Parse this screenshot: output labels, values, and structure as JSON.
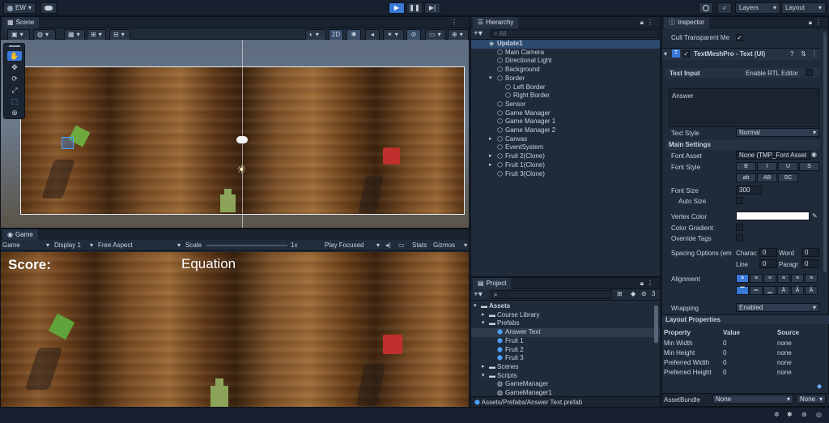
{
  "toolbar": {
    "account": "EW",
    "layers": "Layers",
    "layout": "Layout"
  },
  "scene": {
    "tab": "Scene",
    "mode_2d": "2D"
  },
  "game": {
    "tab": "Game",
    "view": "Game",
    "display": "Display 1",
    "aspect": "Free Aspect",
    "scale_label": "Scale",
    "scale_value": "1x",
    "play_focused": "Play Focused",
    "stats": "Stats",
    "gizmos": "Gizmos",
    "score_text": "Score:",
    "equation_text": "Equation"
  },
  "hierarchy": {
    "tab": "Hierarchy",
    "search_placeholder": "All",
    "items": [
      {
        "label": "Update1",
        "depth": 0,
        "kind": "scene",
        "bold": true
      },
      {
        "label": "Main Camera",
        "depth": 1
      },
      {
        "label": "Directional Light",
        "depth": 1
      },
      {
        "label": "Background",
        "depth": 1
      },
      {
        "label": "Border",
        "depth": 1,
        "arrow": "open"
      },
      {
        "label": "Left Border",
        "depth": 2
      },
      {
        "label": "Right Border",
        "depth": 2
      },
      {
        "label": "Sensor",
        "depth": 1
      },
      {
        "label": "Game Manager",
        "depth": 1
      },
      {
        "label": "Game Manager 1",
        "depth": 1
      },
      {
        "label": "Game Manager 2",
        "depth": 1
      },
      {
        "label": "Canvas",
        "depth": 1,
        "arrow": "closed"
      },
      {
        "label": "EventSystem",
        "depth": 1
      },
      {
        "label": "Fruit 2(Clone)",
        "depth": 1,
        "arrow": "closed"
      },
      {
        "label": "Fruit 1(Clone)",
        "depth": 1,
        "arrow": "closed"
      },
      {
        "label": "Fruit 3(Clone)",
        "depth": 1
      }
    ]
  },
  "project": {
    "tab": "Project",
    "count": "3",
    "items": [
      {
        "label": "Assets",
        "depth": 0,
        "kind": "folder",
        "arrow": "open",
        "bold": true
      },
      {
        "label": "Course Library",
        "depth": 1,
        "kind": "folder",
        "arrow": "closed"
      },
      {
        "label": "Prefabs",
        "depth": 1,
        "kind": "folder",
        "arrow": "open"
      },
      {
        "label": "Answer Text",
        "depth": 2,
        "kind": "prefab",
        "selected": true
      },
      {
        "label": "Fruit 1",
        "depth": 2,
        "kind": "prefab"
      },
      {
        "label": "Fruit 2",
        "depth": 2,
        "kind": "prefab"
      },
      {
        "label": "Fruit 3",
        "depth": 2,
        "kind": "prefab"
      },
      {
        "label": "Scenes",
        "depth": 1,
        "kind": "folder",
        "arrow": "closed"
      },
      {
        "label": "Scripts",
        "depth": 1,
        "kind": "folder",
        "arrow": "open"
      },
      {
        "label": "GameManager",
        "depth": 2,
        "kind": "script"
      },
      {
        "label": "GameManager1",
        "depth": 2,
        "kind": "script"
      }
    ],
    "path": "Assets/Prefabs/Answer Text.prefab"
  },
  "inspector": {
    "tab": "Inspector",
    "cull_transparent": "Cull Transparent Me",
    "component_title": "TextMeshPro - Text (UI)",
    "text_input_label": "Text Input",
    "rtl_label": "Enable RTL Editor",
    "text_value": "Answer",
    "text_style_label": "Text Style",
    "text_style_value": "Normal",
    "main_settings": "Main Settings",
    "font_asset_label": "Font Asset",
    "font_asset_value": "None (TMP_Font Asset",
    "font_style_label": "Font Style",
    "font_style_buttons_1": [
      "B",
      "I",
      "U",
      "S"
    ],
    "font_style_buttons_2": [
      "ab",
      "AB",
      "SC"
    ],
    "font_size_label": "Font Size",
    "font_size_value": "300",
    "auto_size_label": "Auto Size",
    "vertex_color_label": "Vertex Color",
    "color_gradient_label": "Color Gradient",
    "override_tags_label": "Override Tags",
    "spacing_label": "Spacing Options (em",
    "spacing_character_label": "Charac",
    "spacing_character_value": "0",
    "spacing_word_label": "Word",
    "spacing_word_value": "0",
    "spacing_line_label": "Line",
    "spacing_line_value": "0",
    "spacing_paragraph_label": "Paragr",
    "spacing_paragraph_value": "0",
    "alignment_label": "Alignment",
    "wrapping_label": "Wrapping",
    "wrapping_value": "Enabled",
    "layout_properties": "Layout Properties",
    "layout_headers": [
      "Property",
      "Value",
      "Source"
    ],
    "layout_rows": [
      {
        "property": "Min Width",
        "value": "0",
        "source": "none"
      },
      {
        "property": "Min Height",
        "value": "0",
        "source": "none"
      },
      {
        "property": "Preferred Width",
        "value": "0",
        "source": "none"
      },
      {
        "property": "Preferred Height",
        "value": "0",
        "source": "none"
      }
    ],
    "assetbundle_label": "AssetBundle",
    "assetbundle_value": "None",
    "assetbundle_variant": "None"
  },
  "colors": {
    "accent": "#3a78d8",
    "panel_bg": "#202b3a",
    "selected_row": "#2c4a6e"
  }
}
